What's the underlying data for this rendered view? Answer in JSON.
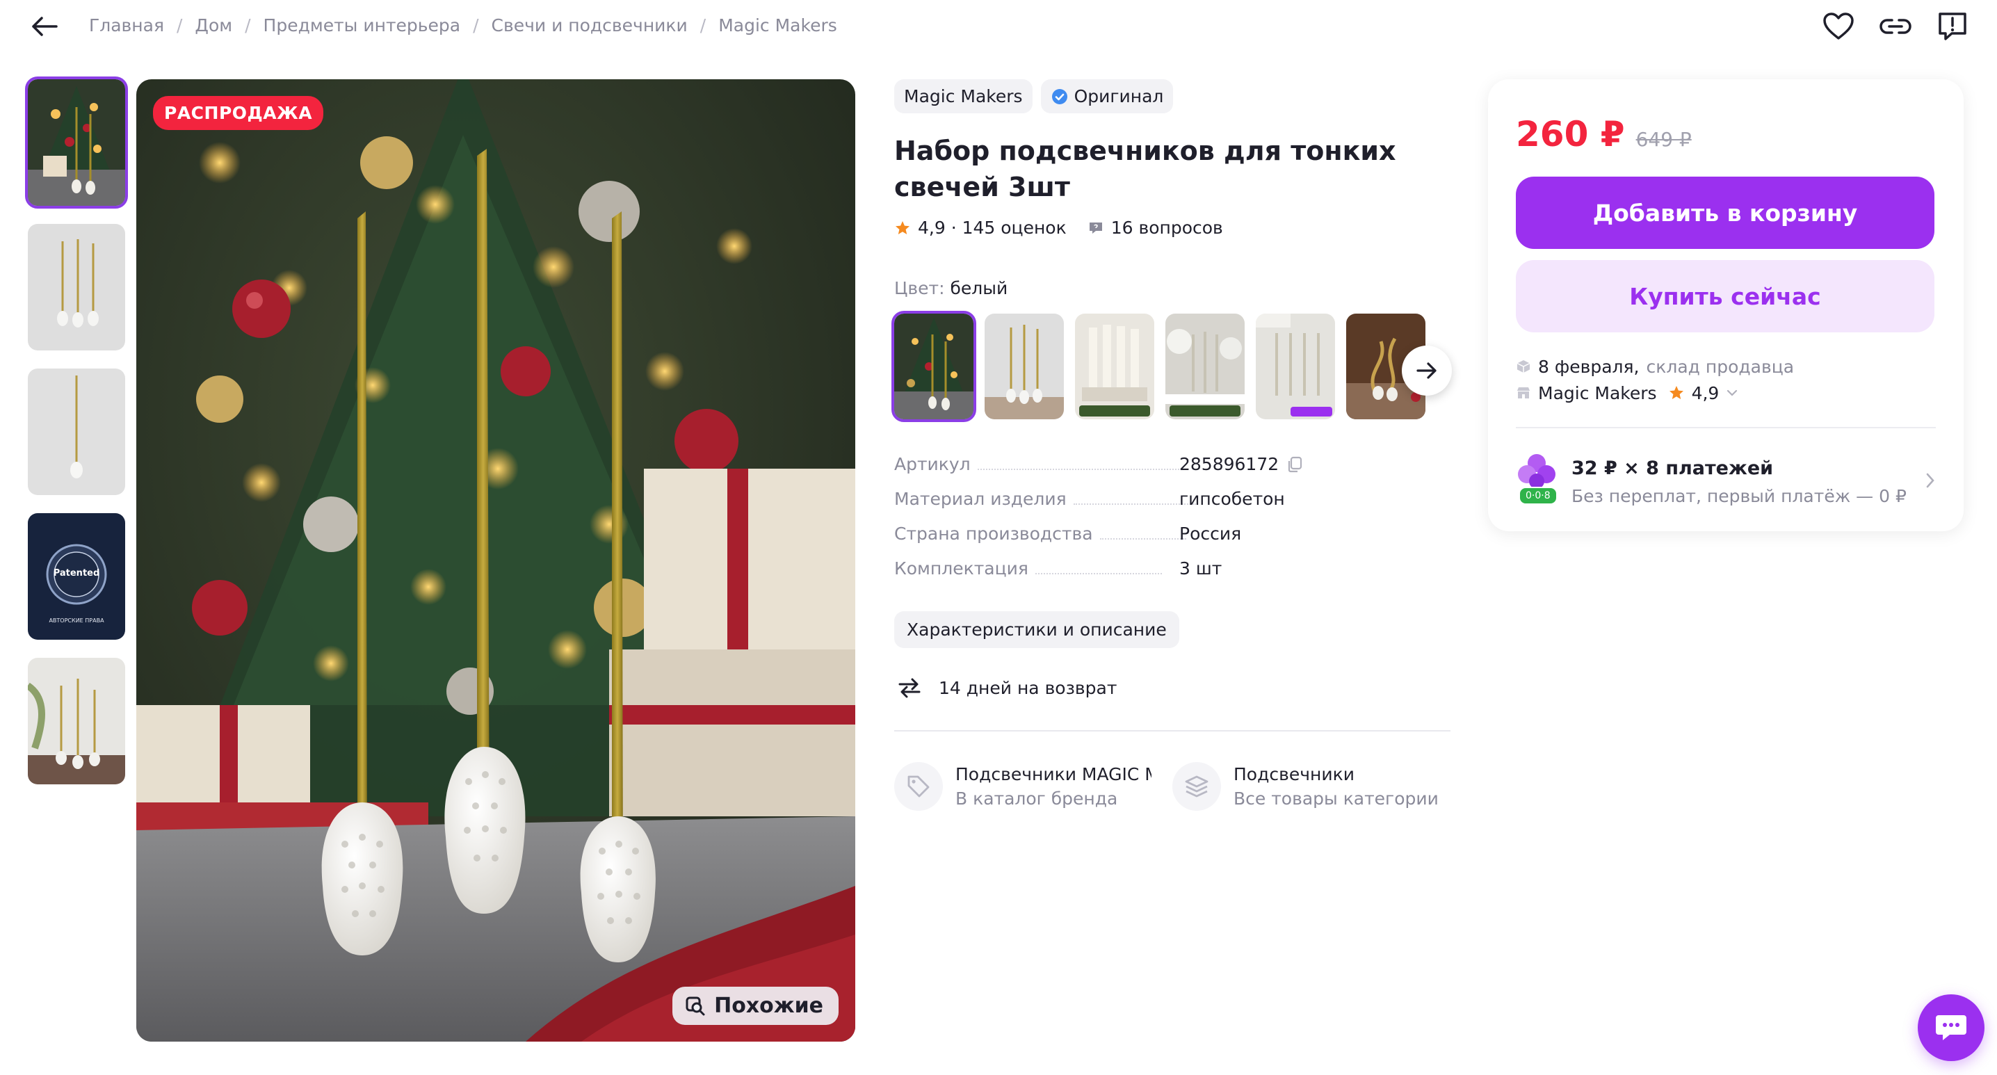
{
  "breadcrumb": {
    "items": [
      "Главная",
      "Дом",
      "Предметы интерьера",
      "Свечи и подсвечники",
      "Magic Makers"
    ],
    "separator": "/"
  },
  "gallery": {
    "badge": "РАСПРОДАЖА",
    "similar_label": "Похожие",
    "thumb_patent_label": "Patented",
    "thumb_patent_caption": "АВТОРСКИЕ ПРАВА",
    "thumbnail_count": 5,
    "active_thumbnail": 1
  },
  "product": {
    "brand_chip": "Magic Makers",
    "original_chip": "Оригинал",
    "title": "Набор подсвечников для тонких свечей 3шт",
    "rating": "4,9 · 145 оценок",
    "questions": "16 вопросов",
    "color_label": "Цвет:",
    "color_value": "белый",
    "variant_count": 6,
    "specs": [
      {
        "name": "Артикул",
        "value": "285896172"
      },
      {
        "name": "Материал изделия",
        "value": "гипсобетон"
      },
      {
        "name": "Страна производства",
        "value": "Россия"
      },
      {
        "name": "Комплектация",
        "value": "3 шт"
      }
    ],
    "description_button": "Характеристики и описание",
    "return_policy": "14 дней на возврат",
    "links": [
      {
        "title": "Подсвечники MAGIC M",
        "subtitle": "В каталог бренда"
      },
      {
        "title": "Подсвечники",
        "subtitle": "Все товары категории"
      }
    ]
  },
  "buy": {
    "price": "260 ₽",
    "old_price": "649 ₽",
    "add_to_cart": "Добавить в корзину",
    "buy_now": "Купить сейчас",
    "delivery_date": "8 февраля,",
    "delivery_source": "склад продавца",
    "seller": "Magic Makers",
    "seller_rating": "4,9",
    "installments_title": "32 ₽ × 8 платежей",
    "installments_subtitle": "Без переплат, первый платёж — 0 ₽",
    "installments_badge": "0·0·8"
  },
  "colors": {
    "accent": "#9b30ef",
    "price": "#f3243e",
    "sale_badge": "#f3243e",
    "star": "#f58a1f"
  }
}
